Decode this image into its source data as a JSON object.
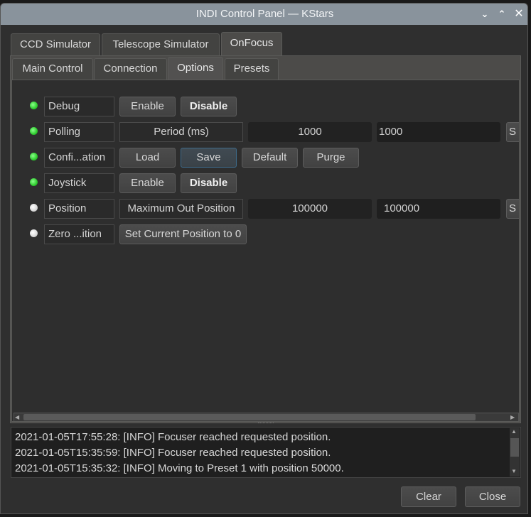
{
  "window": {
    "title": "INDI Control Panel — KStars"
  },
  "titlebar_icons": [
    "chevron-down-icon",
    "chevron-up-icon",
    "close-icon"
  ],
  "device_tabs": [
    {
      "label": "CCD Simulator"
    },
    {
      "label": "Telescope Simulator"
    },
    {
      "label": "OnFocus",
      "active": true
    }
  ],
  "group_tabs": [
    {
      "label": "Main Control"
    },
    {
      "label": "Connection"
    },
    {
      "label": "Options",
      "active": true
    },
    {
      "label": "Presets"
    }
  ],
  "properties": [
    {
      "label": "Debug",
      "state": "ok",
      "buttons": [
        "Enable",
        "Disable"
      ]
    },
    {
      "label": "Polling",
      "state": "ok",
      "element": "Period (ms)",
      "value": "1000",
      "input": "1000",
      "set": "S"
    },
    {
      "label": "Confi...ation",
      "state": "ok",
      "buttons": [
        "Load",
        "Save",
        "Default",
        "Purge"
      ]
    },
    {
      "label": "Joystick",
      "state": "ok",
      "buttons": [
        "Enable",
        "Disable"
      ]
    },
    {
      "label": "Position",
      "state": "idle",
      "element": "Maximum Out Position",
      "value": "100000",
      "input": "100000",
      "set": "S"
    },
    {
      "label": "Zero ...ition",
      "state": "idle",
      "buttons": [
        "Set Current Position to 0"
      ]
    }
  ],
  "log": [
    "2021-01-05T17:55:28: [INFO] Focuser reached requested position.",
    "2021-01-05T15:35:59: [INFO] Focuser reached requested position.",
    "2021-01-05T15:35:32: [INFO] Moving to Preset 1 with position 50000."
  ],
  "footer": {
    "clear": "Clear",
    "close": "Close"
  },
  "colors": {
    "ok": "#2ecc2e",
    "idle": "#d8d8d8",
    "titlebar": "#89939c"
  }
}
